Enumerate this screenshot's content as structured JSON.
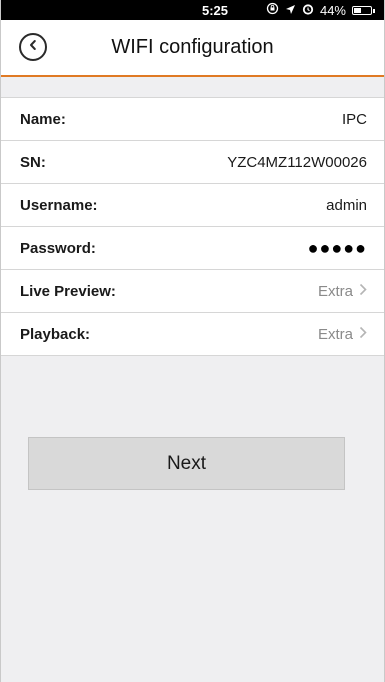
{
  "status_bar": {
    "time": "5:25",
    "battery": "44%",
    "battery_level": 0.44,
    "icons": [
      "lock-rotation-icon",
      "location-icon",
      "alarm-icon",
      "battery-icon"
    ]
  },
  "header": {
    "title": "WIFI configuration",
    "back_icon": "back-chevron-icon"
  },
  "fields": [
    {
      "label": "Name:",
      "value": "IPC"
    },
    {
      "label": "SN:",
      "value": "YZC4MZ112W00026"
    },
    {
      "label": "Username:",
      "value": "admin"
    },
    {
      "label": "Password:",
      "value": "●●●●●"
    },
    {
      "label": "Live Preview:",
      "value": "Extra"
    },
    {
      "label": "Playback:",
      "value": "Extra"
    }
  ],
  "next_button": {
    "label": "Next"
  },
  "colors": {
    "accent": "#e07a24",
    "background": "#efeff1",
    "button": "#d9d9d9"
  }
}
